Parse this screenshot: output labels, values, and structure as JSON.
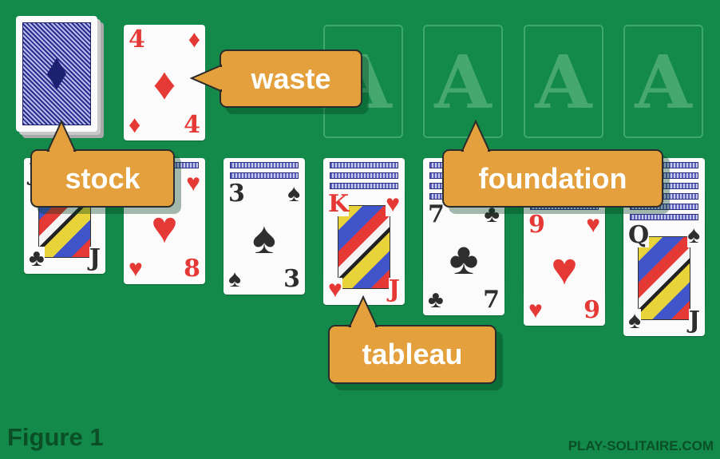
{
  "labels": {
    "stock": "stock",
    "waste": "waste",
    "foundation": "foundation",
    "tableau": "tableau"
  },
  "stock": {
    "face_down": true
  },
  "waste": {
    "rank": "4",
    "suit": "♦",
    "color": "red"
  },
  "foundation": [
    {
      "placeholder": "A"
    },
    {
      "placeholder": "A"
    },
    {
      "placeholder": "A"
    },
    {
      "placeholder": "A"
    }
  ],
  "tableau": [
    {
      "hidden": 0,
      "top": {
        "rank": "J",
        "suit": "♣",
        "color": "black",
        "face_card": true,
        "corner_bottom": "J"
      }
    },
    {
      "hidden": 1,
      "top": {
        "rank": "8",
        "suit": "♥",
        "color": "red"
      }
    },
    {
      "hidden": 2,
      "top": {
        "rank": "3",
        "suit": "♠",
        "color": "black"
      }
    },
    {
      "hidden": 3,
      "top": {
        "rank": "K",
        "suit": "♥",
        "color": "red",
        "face_card": true,
        "corner_bottom": "J"
      }
    },
    {
      "hidden": 4,
      "top": {
        "rank": "7",
        "suit": "♣",
        "color": "black"
      }
    },
    {
      "hidden": 5,
      "top": {
        "rank": "9",
        "suit": "♥",
        "color": "red"
      }
    },
    {
      "hidden": 6,
      "top": {
        "rank": "Q",
        "suit": "♠",
        "color": "black",
        "face_card": true,
        "corner_bottom": "J"
      }
    }
  ],
  "caption": "Figure 1",
  "brand": "PLAY-SOLITAIRE.COM",
  "colors": {
    "felt": "#138a4a",
    "callout": "#e3a03c",
    "red_suit": "#e53935",
    "black_suit": "#2e2e2e"
  }
}
